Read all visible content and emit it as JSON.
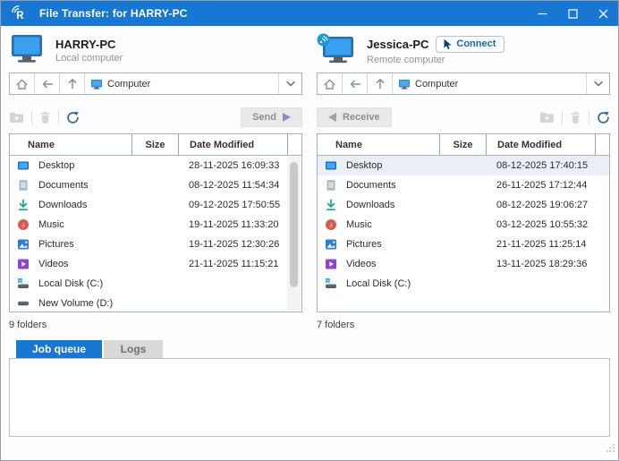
{
  "window": {
    "title": "File Transfer: for HARRY-PC"
  },
  "icons": {
    "logo_letter": "R",
    "music_note": "♪"
  },
  "colors": {
    "titlebar": "#1877d2",
    "tab_active": "#1877d2",
    "connect_text": "#1465b0",
    "refresh_icon": "#3c6a97",
    "disabled_icon": "#d2d6da",
    "send_arrow": "#8093c5",
    "receive_arrow": "#9aa5ae",
    "selected_row": "#e9eff5"
  },
  "local_panel": {
    "computer_name": "HARRY-PC",
    "computer_type": "Local computer",
    "nav_path": "Computer",
    "send_label": "Send",
    "status": "9 folders",
    "columns": [
      "Name",
      "Size",
      "Date Modified"
    ],
    "rows": [
      {
        "name": "Desktop",
        "size": "",
        "date": "28-11-2025 16:09:33"
      },
      {
        "name": "Documents",
        "size": "",
        "date": "08-12-2025 11:54:34"
      },
      {
        "name": "Downloads",
        "size": "",
        "date": "09-12-2025 17:50:55"
      },
      {
        "name": "Music",
        "size": "",
        "date": "19-11-2025 11:33:20"
      },
      {
        "name": "Pictures",
        "size": "",
        "date": "19-11-2025 12:30:26"
      },
      {
        "name": "Videos",
        "size": "",
        "date": "21-11-2025 11:15:21"
      },
      {
        "name": "Local Disk (C:)",
        "size": "",
        "date": ""
      },
      {
        "name": "New Volume (D:)",
        "size": "",
        "date": ""
      }
    ]
  },
  "remote_panel": {
    "computer_name": "Jessica-PC",
    "computer_type": "Remote computer",
    "connect_label": "Connect",
    "nav_path": "Computer",
    "receive_label": "Receive",
    "status": "7 folders",
    "columns": [
      "Name",
      "Size",
      "Date Modified"
    ],
    "rows": [
      {
        "name": "Desktop",
        "size": "",
        "date": "08-12-2025 17:40:15"
      },
      {
        "name": "Documents",
        "size": "",
        "date": "26-11-2025 17:12:44"
      },
      {
        "name": "Downloads",
        "size": "",
        "date": "08-12-2025 19:06:27"
      },
      {
        "name": "Music",
        "size": "",
        "date": "03-12-2025 10:55:32"
      },
      {
        "name": "Pictures",
        "size": "",
        "date": "21-11-2025 11:25:14"
      },
      {
        "name": "Videos",
        "size": "",
        "date": "13-11-2025 18:29:36"
      },
      {
        "name": "Local Disk (C:)",
        "size": "",
        "date": ""
      }
    ]
  },
  "bottom": {
    "tabs": [
      {
        "label": "Job queue"
      },
      {
        "label": "Logs"
      }
    ]
  }
}
